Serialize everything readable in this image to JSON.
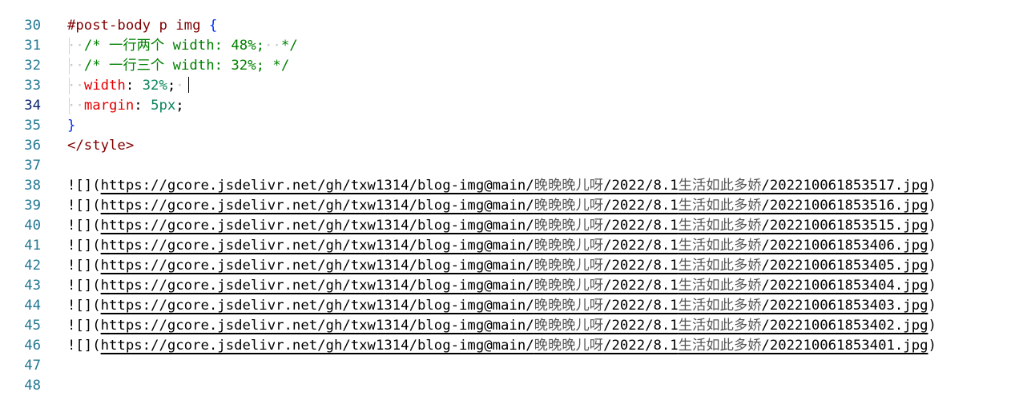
{
  "editor": {
    "lines": [
      {
        "num": "30"
      },
      {
        "num": "31",
        "selector": "#post-body p img ",
        "open_brace": "{"
      },
      {
        "num": "32",
        "comment_a": "/* ",
        "comment_cjk": "一行两个",
        "comment_b": " width: 48%;",
        "comment_c": "*/"
      },
      {
        "num": "33",
        "comment_a": "/* ",
        "comment_cjk": "一行三个",
        "comment_b": " width: 32%; */"
      },
      {
        "num": "34",
        "prop": "width",
        "colon": ": ",
        "value": "32%",
        "semi": ";"
      },
      {
        "num": "35",
        "prop": "margin",
        "colon": ": ",
        "value": "5px",
        "semi": ";"
      },
      {
        "num": "36",
        "close_brace": "}"
      },
      {
        "num": "37",
        "tag": "</style>"
      },
      {
        "num": "38"
      },
      {
        "num": "39",
        "prefix": "![](",
        "url_a": "https://gcore.jsdelivr.net/gh/txw1314/blog-img@main/",
        "url_cjk1": "晚晚晚儿呀",
        "url_b": "/2022/8.1",
        "url_cjk2": "生活如此多娇",
        "url_c": "/202210061853517.jpg",
        "suffix": ")"
      },
      {
        "num": "40",
        "prefix": "![](",
        "url_a": "https://gcore.jsdelivr.net/gh/txw1314/blog-img@main/",
        "url_cjk1": "晚晚晚儿呀",
        "url_b": "/2022/8.1",
        "url_cjk2": "生活如此多娇",
        "url_c": "/202210061853516.jpg",
        "suffix": ")"
      },
      {
        "num": "41",
        "prefix": "![](",
        "url_a": "https://gcore.jsdelivr.net/gh/txw1314/blog-img@main/",
        "url_cjk1": "晚晚晚儿呀",
        "url_b": "/2022/8.1",
        "url_cjk2": "生活如此多娇",
        "url_c": "/202210061853515.jpg",
        "suffix": ")"
      },
      {
        "num": "42",
        "prefix": "![](",
        "url_a": "https://gcore.jsdelivr.net/gh/txw1314/blog-img@main/",
        "url_cjk1": "晚晚晚儿呀",
        "url_b": "/2022/8.1",
        "url_cjk2": "生活如此多娇",
        "url_c": "/202210061853406.jpg",
        "suffix": ")"
      },
      {
        "num": "43",
        "prefix": "![](",
        "url_a": "https://gcore.jsdelivr.net/gh/txw1314/blog-img@main/",
        "url_cjk1": "晚晚晚儿呀",
        "url_b": "/2022/8.1",
        "url_cjk2": "生活如此多娇",
        "url_c": "/202210061853405.jpg",
        "suffix": ")"
      },
      {
        "num": "44",
        "prefix": "![](",
        "url_a": "https://gcore.jsdelivr.net/gh/txw1314/blog-img@main/",
        "url_cjk1": "晚晚晚儿呀",
        "url_b": "/2022/8.1",
        "url_cjk2": "生活如此多娇",
        "url_c": "/202210061853404.jpg",
        "suffix": ")"
      },
      {
        "num": "45",
        "prefix": "![](",
        "url_a": "https://gcore.jsdelivr.net/gh/txw1314/blog-img@main/",
        "url_cjk1": "晚晚晚儿呀",
        "url_b": "/2022/8.1",
        "url_cjk2": "生活如此多娇",
        "url_c": "/202210061853403.jpg",
        "suffix": ")"
      },
      {
        "num": "46",
        "prefix": "![](",
        "url_a": "https://gcore.jsdelivr.net/gh/txw1314/blog-img@main/",
        "url_cjk1": "晚晚晚儿呀",
        "url_b": "/2022/8.1",
        "url_cjk2": "生活如此多娇",
        "url_c": "/202210061853402.jpg",
        "suffix": ")"
      },
      {
        "num": "47",
        "prefix": "![](",
        "url_a": "https://gcore.jsdelivr.net/gh/txw1314/blog-img@main/",
        "url_cjk1": "晚晚晚儿呀",
        "url_b": "/2022/8.1",
        "url_cjk2": "生活如此多娇",
        "url_c": "/202210061853401.jpg",
        "suffix": ")"
      },
      {
        "num": "48"
      }
    ]
  },
  "colors": {
    "line_number": "#237893",
    "current_line_number": "#0b216f",
    "selector": "#800000",
    "brace": "#0431fa",
    "comment": "#008000",
    "property": "#e50000",
    "number": "#098658"
  }
}
